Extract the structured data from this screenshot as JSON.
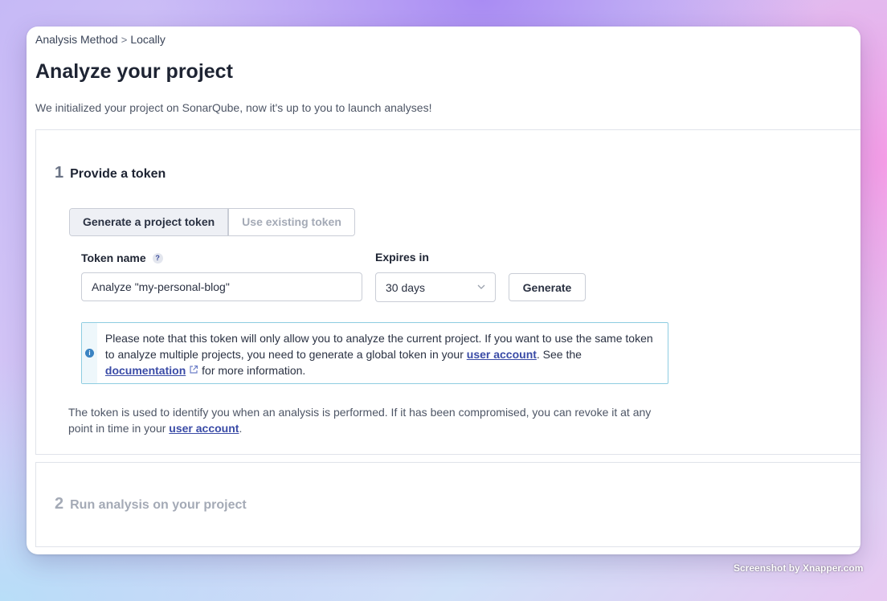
{
  "breadcrumb": {
    "first": "Analysis Method",
    "separator": ">",
    "second": "Locally"
  },
  "page": {
    "title": "Analyze your project",
    "intro": "We initialized your project on SonarQube, now it's up to you to launch analyses!"
  },
  "step1": {
    "number": "1",
    "title": "Provide a token",
    "tabs": {
      "generate": "Generate a project token",
      "existing": "Use existing token"
    },
    "token_name_label": "Token name",
    "help_glyph": "?",
    "token_name_value": "Analyze \"my-personal-blog\"",
    "expires_label": "Expires in",
    "expires_value": "30 days",
    "generate_label": "Generate",
    "alert": {
      "text1": "Please note that this token will only allow you to analyze the current project. If you want to use the same token to analyze multiple projects, you need to generate a global token in your ",
      "link1": "user account",
      "text2": ". See the ",
      "link2": "documentation",
      "text3": " for more information."
    },
    "note": {
      "text1": "The token is used to identify you when an analysis is performed. If it has been compromised, you can revoke it at any point in time in your ",
      "link": "user account",
      "text2": "."
    }
  },
  "step2": {
    "number": "2",
    "title": "Run analysis on your project"
  },
  "credit": "Screenshot by Xnapper.com"
}
